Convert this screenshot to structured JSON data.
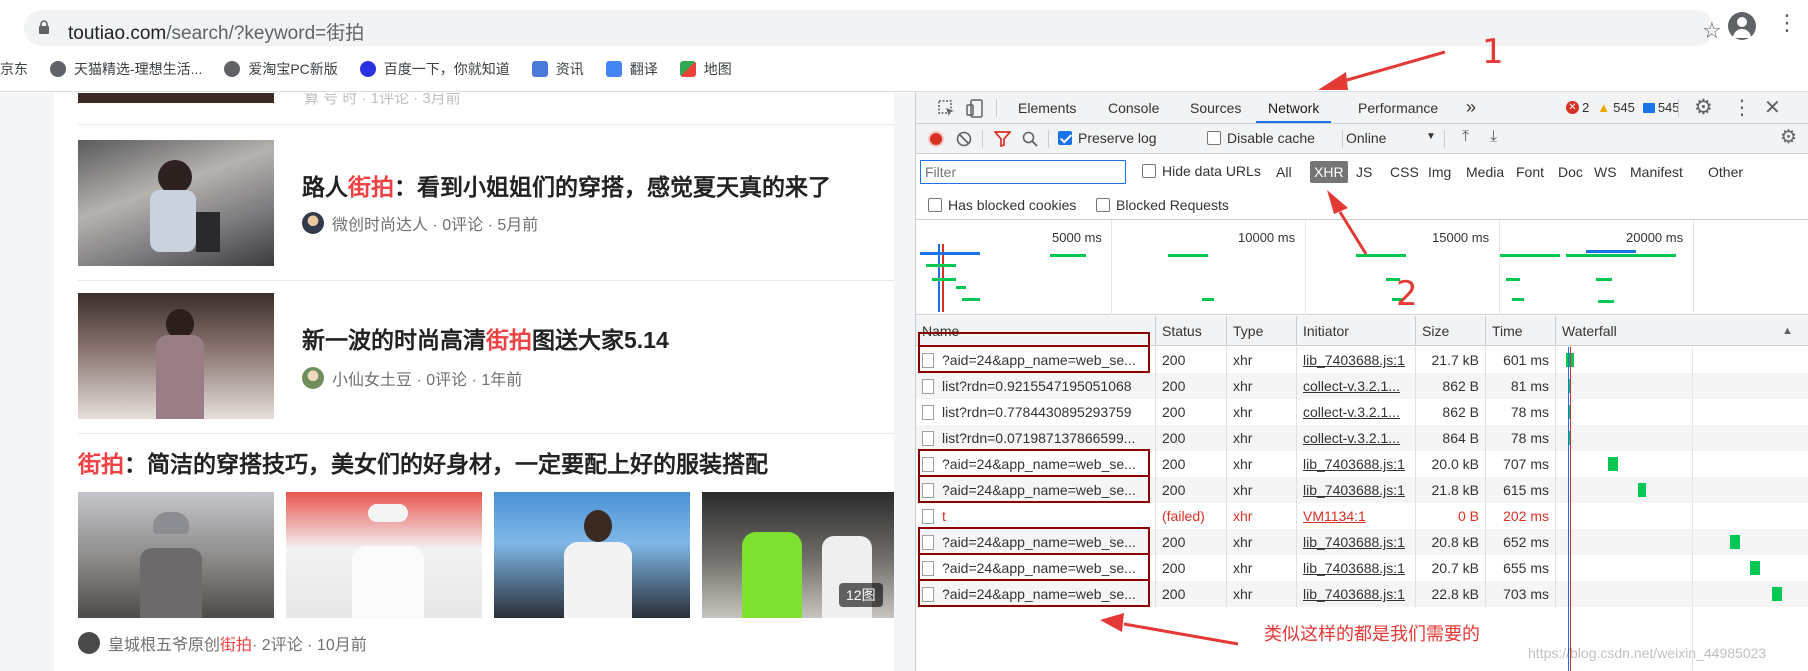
{
  "browser": {
    "url_host": "toutiao.com",
    "url_rest": "/search/?keyword=街拍",
    "bookmarks": [
      "京东",
      "天猫精选-理想生活...",
      "爱淘宝PC新版",
      "百度一下，你就知道",
      "资讯",
      "翻译",
      "地图"
    ]
  },
  "page": {
    "top_partial_meta": "算 号 时 · 1评论 · 3月前",
    "articles": [
      {
        "title_before": "路人",
        "title_hl": "街拍",
        "title_after": "：看到小姐姐们的穿搭，感觉夏天真的来了",
        "meta": "微创时尚达人 · 0评论 · 5月前"
      },
      {
        "title_before": "新一波的时尚高清",
        "title_hl": "街拍",
        "title_after": "图送大家5.14",
        "meta": "小仙女土豆 · 0评论 · 1年前"
      },
      {
        "title_before": "",
        "title_hl": "街拍",
        "title_after": "：简洁的穿搭技巧，美女们的好身材，一定要配上好的服装搭配",
        "meta_before": "皇城根五爷原创",
        "meta_hl": "街拍",
        "meta_after": " · 2评论 · 10月前",
        "image_count": "12图"
      }
    ]
  },
  "devtools": {
    "tabs": [
      "Elements",
      "Console",
      "Sources",
      "Network",
      "Performance"
    ],
    "active_tab": "Network",
    "more_tabs": "»",
    "errors": "2",
    "warnings": "545",
    "messages": "545",
    "toolbar": {
      "preserve_log": "Preserve log",
      "disable_cache": "Disable cache",
      "throttle": "Online"
    },
    "filter": {
      "placeholder": "Filter",
      "hide_data_urls": "Hide data URLs",
      "types": [
        "All",
        "XHR",
        "JS",
        "CSS",
        "Img",
        "Media",
        "Font",
        "Doc",
        "WS",
        "Manifest",
        "Other"
      ],
      "active_type": "XHR",
      "has_blocked_cookies": "Has blocked cookies",
      "blocked_requests": "Blocked Requests"
    },
    "overview_ticks": [
      "5000 ms",
      "10000 ms",
      "15000 ms",
      "20000 ms"
    ],
    "columns": [
      "Name",
      "Status",
      "Type",
      "Initiator",
      "Size",
      "Time",
      "Waterfall"
    ],
    "sort_indicator": "▲",
    "rows": [
      {
        "name": "?aid=24&app_name=web_se...",
        "status": "200",
        "type": "xhr",
        "initiator": "lib_7403688.js:1",
        "size": "21.7 kB",
        "time": "601 ms"
      },
      {
        "name": "list?rdn=0.9215547195051068",
        "status": "200",
        "type": "xhr",
        "initiator": "collect-v.3.2.1...",
        "size": "862 B",
        "time": "81 ms"
      },
      {
        "name": "list?rdn=0.7784430895293759",
        "status": "200",
        "type": "xhr",
        "initiator": "collect-v.3.2.1...",
        "size": "862 B",
        "time": "78 ms"
      },
      {
        "name": "list?rdn=0.071987137866599...",
        "status": "200",
        "type": "xhr",
        "initiator": "collect-v.3.2.1...",
        "size": "864 B",
        "time": "78 ms"
      },
      {
        "name": "?aid=24&app_name=web_se...",
        "status": "200",
        "type": "xhr",
        "initiator": "lib_7403688.js:1",
        "size": "20.0 kB",
        "time": "707 ms"
      },
      {
        "name": "?aid=24&app_name=web_se...",
        "status": "200",
        "type": "xhr",
        "initiator": "lib_7403688.js:1",
        "size": "21.8 kB",
        "time": "615 ms"
      },
      {
        "name": "t",
        "status": "(failed)",
        "type": "xhr",
        "initiator": "VM1134:1",
        "size": "0 B",
        "time": "202 ms"
      },
      {
        "name": "?aid=24&app_name=web_se...",
        "status": "200",
        "type": "xhr",
        "initiator": "lib_7403688.js:1",
        "size": "20.8 kB",
        "time": "652 ms"
      },
      {
        "name": "?aid=24&app_name=web_se...",
        "status": "200",
        "type": "xhr",
        "initiator": "lib_7403688.js:1",
        "size": "20.7 kB",
        "time": "655 ms"
      },
      {
        "name": "?aid=24&app_name=web_se...",
        "status": "200",
        "type": "xhr",
        "initiator": "lib_7403688.js:1",
        "size": "22.8 kB",
        "time": "703 ms"
      }
    ]
  },
  "annotations": {
    "label_1": "1",
    "label_2": "2",
    "note": "类似这样的都是我们需要的",
    "watermark": "https://blog.csdn.net/weixin_44985023"
  },
  "colors": {
    "accent": "#1a73e8",
    "highlight": "#f04142",
    "annotation": "#e53935",
    "box": "#8b0000",
    "waterfall": "#00c853"
  }
}
